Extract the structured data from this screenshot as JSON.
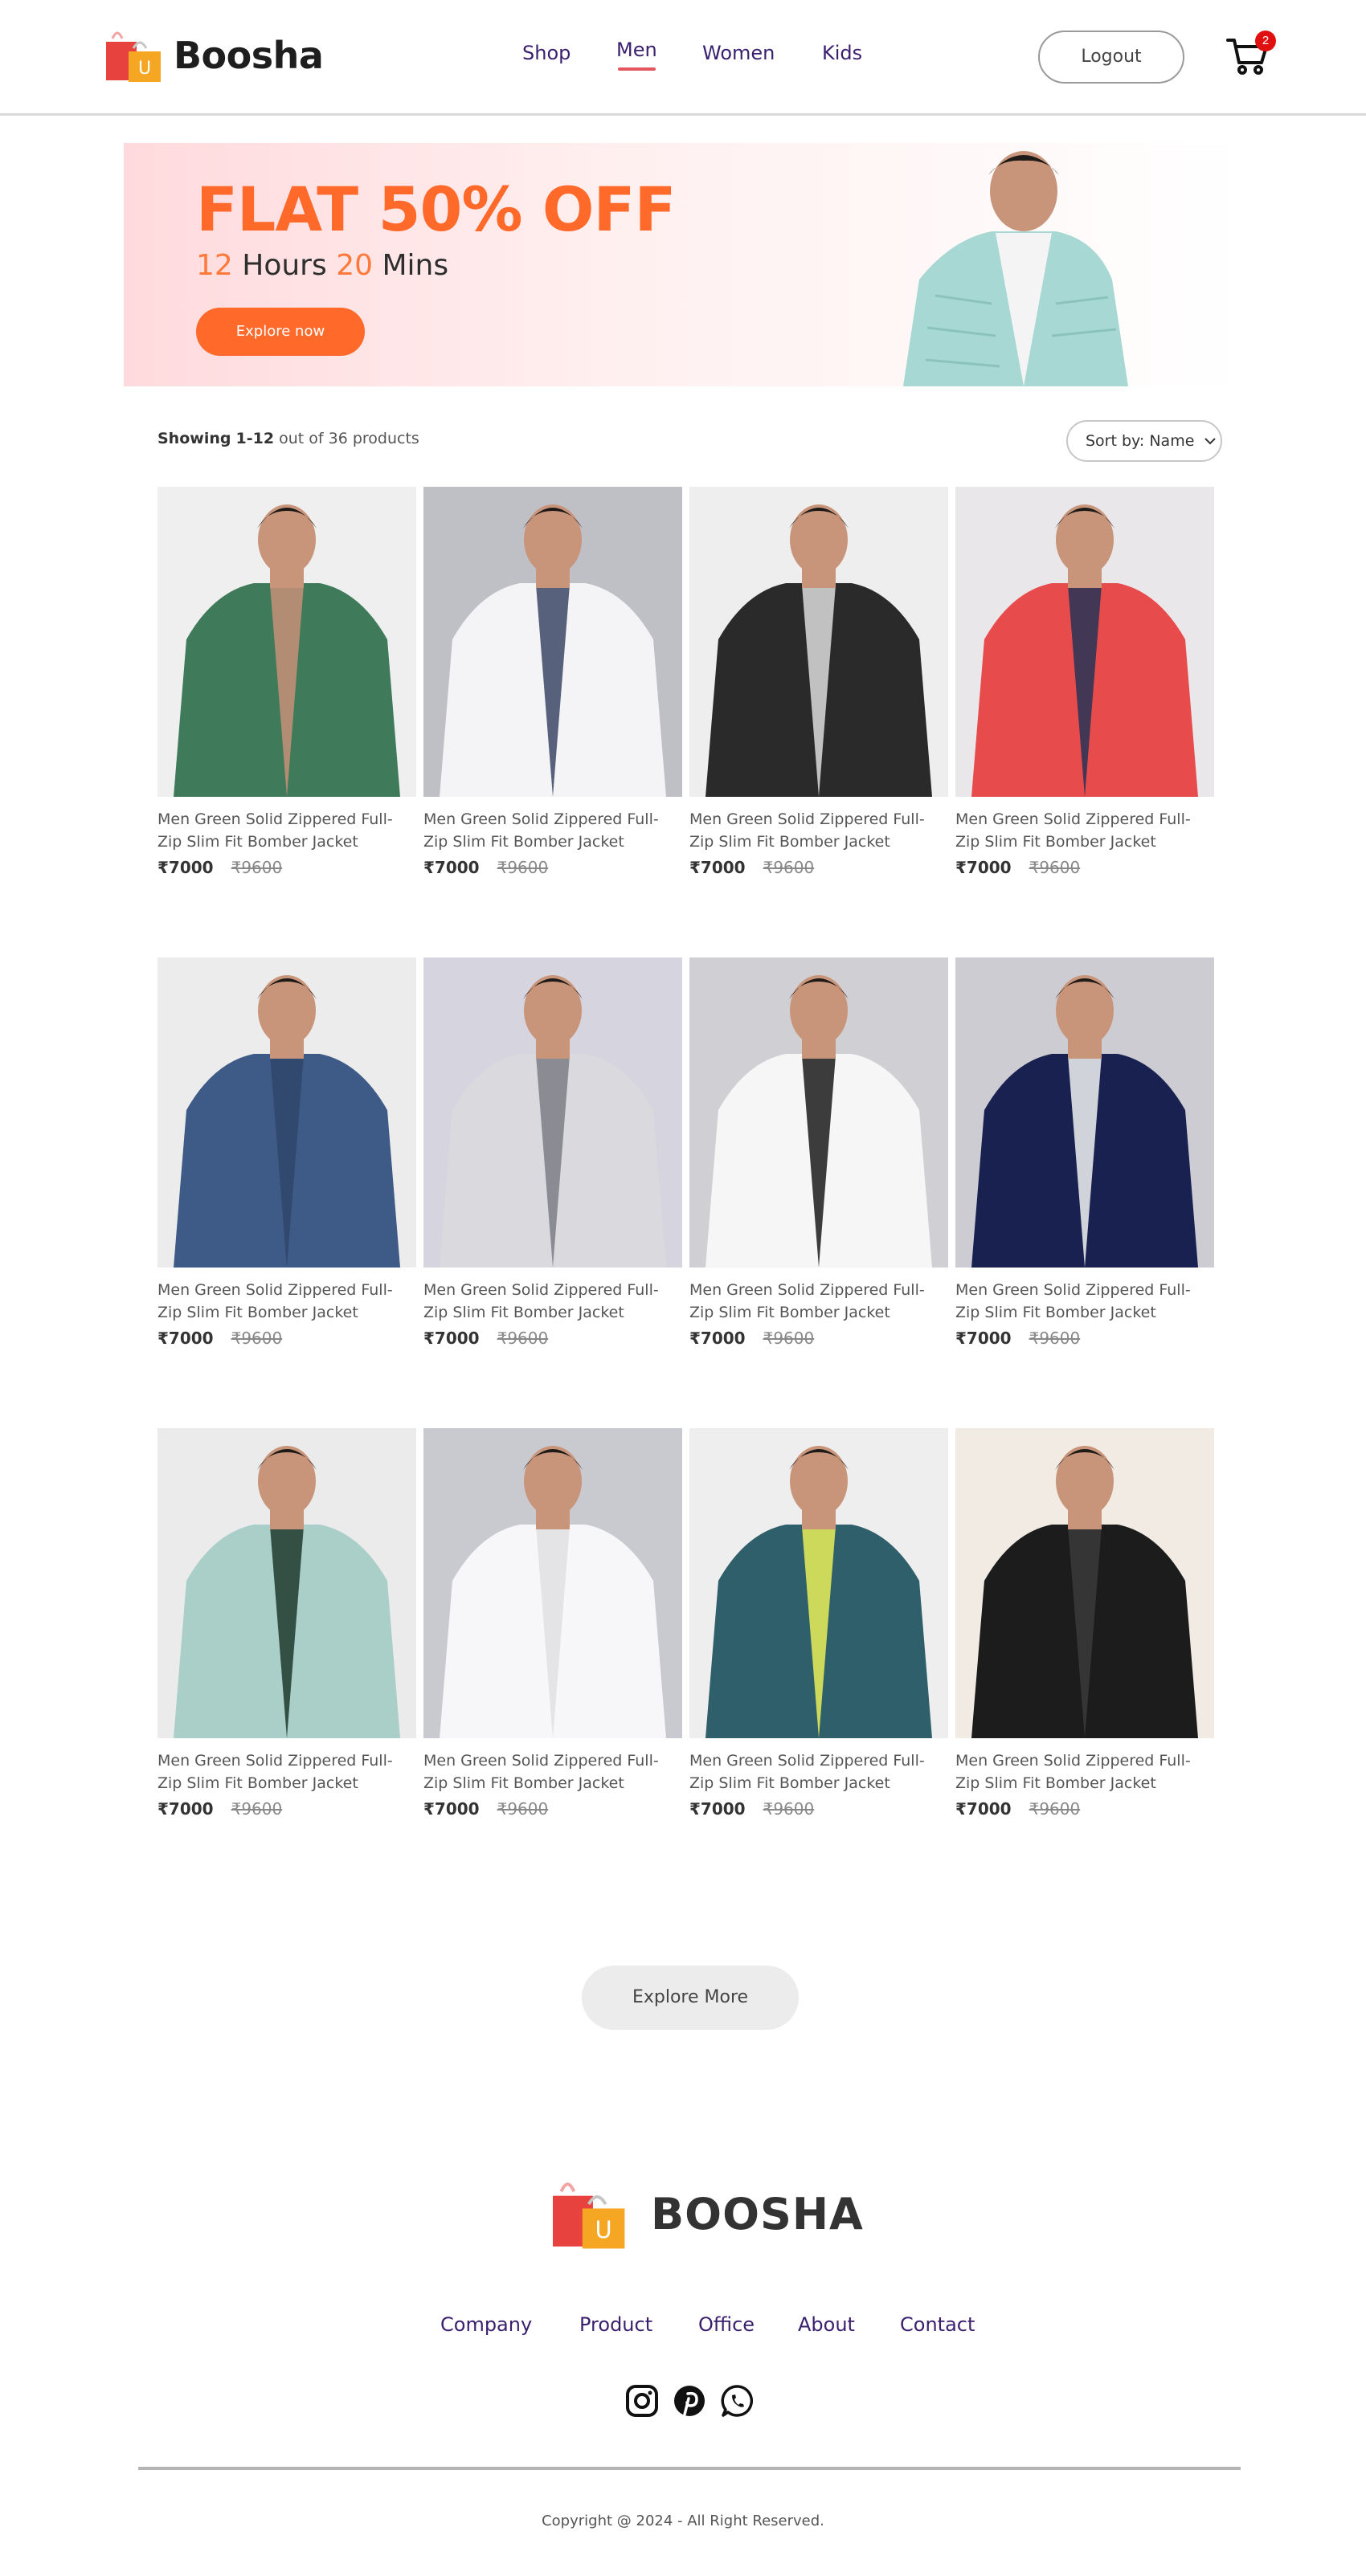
{
  "header": {
    "brand": "Boosha",
    "nav": [
      "Shop",
      "Men",
      "Women",
      "Kids"
    ],
    "active_nav": "Men",
    "logout_label": "Logout",
    "cart_count": "2"
  },
  "hero": {
    "title": "FLAT 50% OFF",
    "hours_value": "12",
    "hours_label": "Hours",
    "mins_value": "20",
    "mins_label": "Mins",
    "button_label": "Explore now"
  },
  "listing": {
    "showing_prefix": "Showing",
    "showing_range": "1-12",
    "showing_suffix": "out of 36 products",
    "sort_label": "Sort by: Name"
  },
  "products": [
    {
      "name": "Men Green Solid Zippered Full-Zip Slim Fit Bomber Jacket",
      "price": "₹7000",
      "old_price": "₹9600",
      "image": "green-hooded-jacket"
    },
    {
      "name": "Men Green Solid Zippered Full-Zip Slim Fit Bomber Jacket",
      "price": "₹7000",
      "old_price": "₹9600",
      "image": "white-navy-puffer-jacket"
    },
    {
      "name": "Men Green Solid Zippered Full-Zip Slim Fit Bomber Jacket",
      "price": "₹7000",
      "old_price": "₹9600",
      "image": "black-white-print-jacket"
    },
    {
      "name": "Men Green Solid Zippered Full-Zip Slim Fit Bomber Jacket",
      "price": "₹7000",
      "old_price": "₹9600",
      "image": "red-colorblock-jacket"
    },
    {
      "name": "Men Green Solid Zippered Full-Zip Slim Fit Bomber Jacket",
      "price": "₹7000",
      "old_price": "₹9600",
      "image": "denim-jacket"
    },
    {
      "name": "Men Green Solid Zippered Full-Zip Slim Fit Bomber Jacket",
      "price": "₹7000",
      "old_price": "₹9600",
      "image": "grey-zip-jacket"
    },
    {
      "name": "Men Green Solid Zippered Full-Zip Slim Fit Bomber Jacket",
      "price": "₹7000",
      "old_price": "₹9600",
      "image": "white-track-jacket"
    },
    {
      "name": "Men Green Solid Zippered Full-Zip Slim Fit Bomber Jacket",
      "price": "₹7000",
      "old_price": "₹9600",
      "image": "navy-zip-jacket"
    },
    {
      "name": "Men Green Solid Zippered Full-Zip Slim Fit Bomber Jacket",
      "price": "₹7000",
      "old_price": "₹9600",
      "image": "mint-colorblock-windcheater"
    },
    {
      "name": "Men Green Solid Zippered Full-Zip Slim Fit Bomber Jacket",
      "price": "₹7000",
      "old_price": "₹9600",
      "image": "white-hooded-jacket"
    },
    {
      "name": "Men Green Solid Zippered Full-Zip Slim Fit Bomber Jacket",
      "price": "₹7000",
      "old_price": "₹9600",
      "image": "teal-jacket-yellow-hoodie"
    },
    {
      "name": "Men Green Solid Zippered Full-Zip Slim Fit Bomber Jacket",
      "price": "₹7000",
      "old_price": "₹9600",
      "image": "black-leather-biker-jacket"
    }
  ],
  "explore_more_label": "Explore More",
  "footer": {
    "brand": "BOOSHA",
    "links": [
      "Company",
      "Product",
      "Office",
      "About",
      "Contact"
    ],
    "social": [
      "instagram-icon",
      "pinterest-icon",
      "whatsapp-icon"
    ],
    "copyright": "Copyright @ 2024 - All Right Reserved."
  },
  "colors": {
    "accent": "#ff6a2b",
    "nav_text": "#3a1f6e",
    "nav_underline": "#e4575f",
    "badge": "#e01010"
  }
}
